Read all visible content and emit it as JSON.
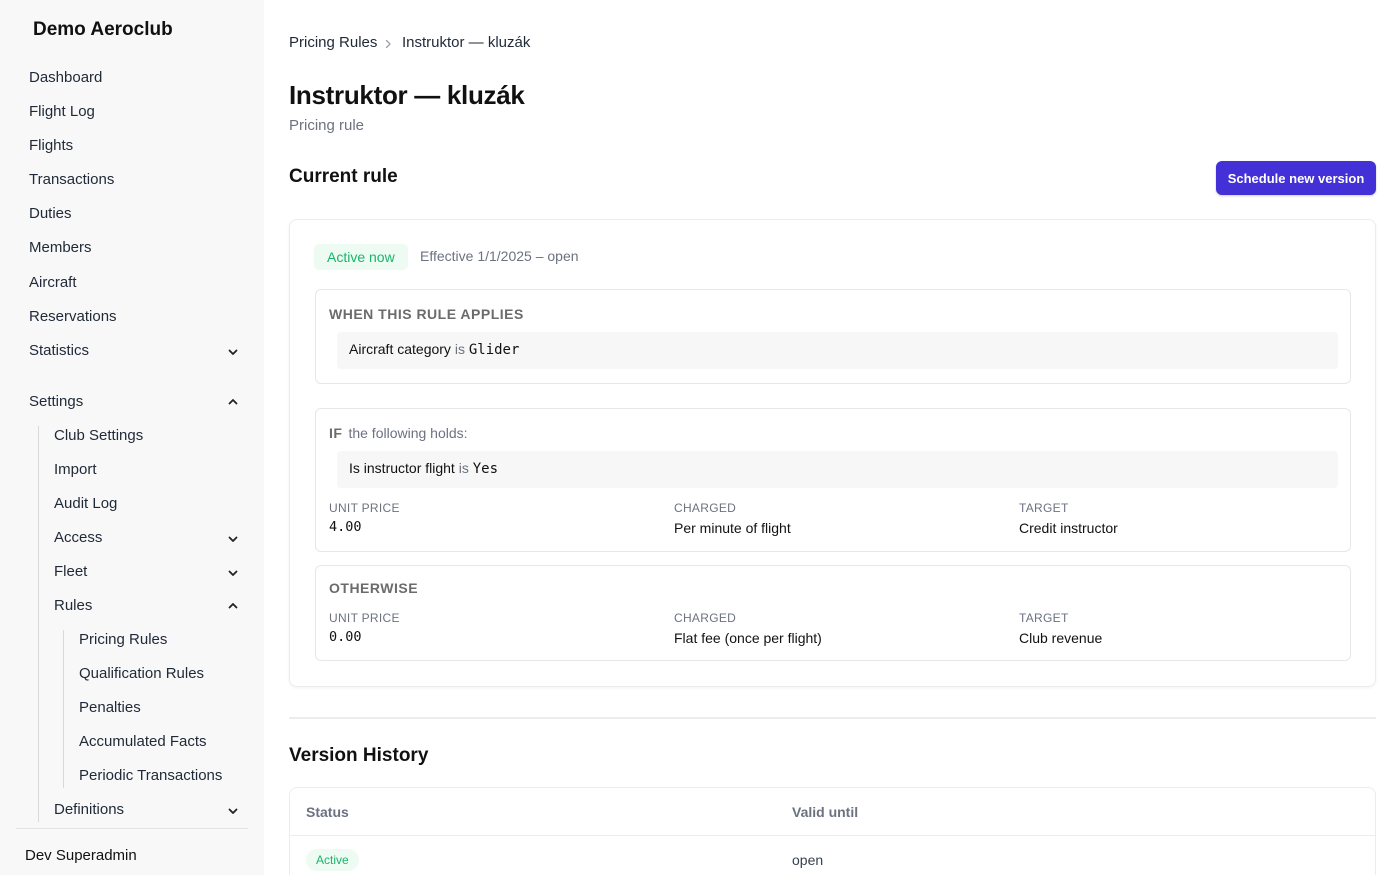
{
  "sidebar": {
    "brand": "Demo Aeroclub",
    "nav": {
      "dashboard": "Dashboard",
      "flight_log": "Flight Log",
      "flights": "Flights",
      "transactions": "Transactions",
      "duties": "Duties",
      "members": "Members",
      "aircraft": "Aircraft",
      "reservations": "Reservations",
      "statistics": "Statistics",
      "settings": "Settings",
      "club_settings": "Club Settings",
      "import": "Import",
      "audit_log": "Audit Log",
      "access": "Access",
      "fleet": "Fleet",
      "rules": "Rules",
      "pricing_rules": "Pricing Rules",
      "qualification_rules": "Qualification Rules",
      "penalties": "Penalties",
      "accumulated_facts": "Accumulated Facts",
      "periodic_transactions": "Periodic Transactions",
      "definitions": "Definitions"
    },
    "user": "Dev Superadmin"
  },
  "breadcrumb": {
    "parent": "Pricing Rules",
    "current": "Instruktor — kluzák"
  },
  "page": {
    "title": "Instruktor — kluzák",
    "subtitle": "Pricing rule"
  },
  "current_rule": {
    "heading": "Current rule",
    "schedule_button": "Schedule new version",
    "status_badge": "Active now",
    "effective": "Effective 1/1/2025 – open",
    "when": {
      "label": "WHEN THIS RULE APPLIES",
      "field": "Aircraft category",
      "op": "is",
      "value": "Glider"
    },
    "if_block": {
      "keyword": "IF",
      "text": "the following holds:",
      "field": "Is instructor flight",
      "op": "is",
      "value": "Yes",
      "unit_price_label": "UNIT PRICE",
      "unit_price": "4.00",
      "charged_label": "CHARGED",
      "charged": "Per minute of flight",
      "target_label": "TARGET",
      "target": "Credit instructor"
    },
    "otherwise": {
      "label": "OTHERWISE",
      "unit_price_label": "UNIT PRICE",
      "unit_price": "0.00",
      "charged_label": "CHARGED",
      "charged": "Flat fee (once per flight)",
      "target_label": "TARGET",
      "target": "Club revenue"
    }
  },
  "history": {
    "heading": "Version History",
    "columns": [
      "Status",
      "Valid until"
    ],
    "rows": [
      {
        "status": "Active",
        "valid_until": "open"
      }
    ]
  },
  "colors": {
    "primary": "#4330d6",
    "success": "#19b56a",
    "success_bg": "#eefbf2",
    "sidebar_bg": "#f8f8f8"
  }
}
